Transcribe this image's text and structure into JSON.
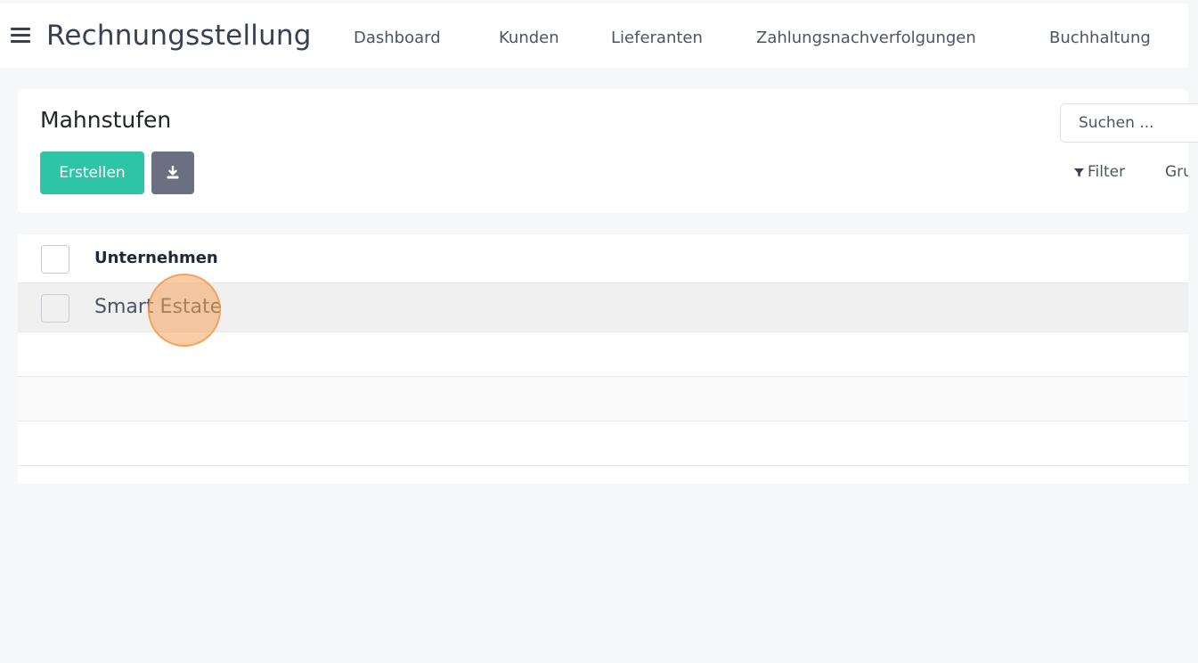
{
  "header": {
    "app_title": "Rechnungsstellung",
    "menu_icon": "hamburger-menu-icon",
    "nav_items": [
      {
        "label": "Dashboard"
      },
      {
        "label": "Kunden"
      },
      {
        "label": "Lieferanten"
      },
      {
        "label": "Zahlungsnachverfolgungen"
      },
      {
        "label": "Buchhaltung"
      }
    ]
  },
  "control_panel": {
    "title": "Mahnstufen",
    "create_label": "Erstellen",
    "download_icon": "download-icon",
    "search_placeholder": "Suchen ...",
    "filter_label": "Filter",
    "group_label": "Gruppieren nach"
  },
  "list": {
    "column_header": "Unternehmen",
    "rows": [
      {
        "company": "Smart Estate"
      }
    ]
  },
  "colors": {
    "accent": "#2ec4a8",
    "secondary_button": "#6b6f82",
    "click_highlight": "#f5a45c"
  }
}
